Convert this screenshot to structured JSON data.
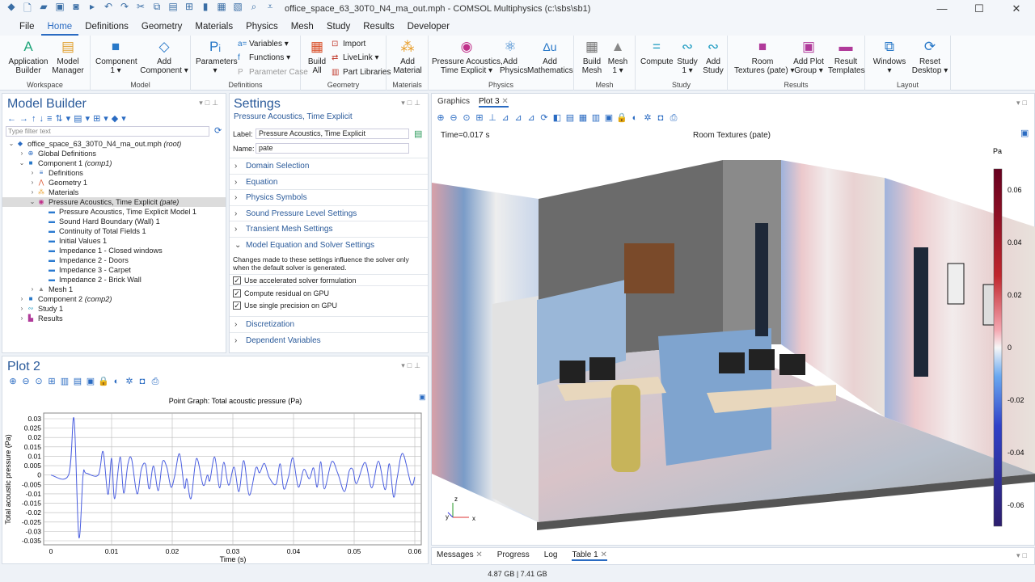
{
  "window": {
    "title": "office_space_63_30T0_N4_ma_out.mph - COMSOL Multiphysics (c:\\sbs\\sb1)",
    "quick_access_icons": [
      "app-icon",
      "new-icon",
      "open-icon",
      "save-icon",
      "save-as-icon",
      "run-icon",
      "undo-icon",
      "redo-icon",
      "cut-icon",
      "copy-icon",
      "paste-icon",
      "duplicate-icon",
      "delete-icon",
      "select-icon",
      "clear-icon",
      "find-icon",
      "customize-icon"
    ],
    "controls": [
      "minimize",
      "maximize",
      "close"
    ]
  },
  "menu": {
    "tabs": [
      "File",
      "Home",
      "Definitions",
      "Geometry",
      "Materials",
      "Physics",
      "Mesh",
      "Study",
      "Results",
      "Developer"
    ],
    "active": "Home"
  },
  "ribbon": {
    "workspace": {
      "label": "Workspace",
      "app_builder": "Application\nBuilder",
      "model_manager": "Model\nManager"
    },
    "model": {
      "label": "Model",
      "component": "Component\n1 ▾",
      "add_component": "Add\nComponent ▾"
    },
    "definitions": {
      "label": "Definitions",
      "parameters": "Parameters\n▾",
      "variables": "Variables ▾",
      "functions": "Functions ▾",
      "parameter_case": "Parameter Case"
    },
    "geometry": {
      "label": "Geometry",
      "build_all": "Build\nAll",
      "import": "Import",
      "livelink": "LiveLink ▾",
      "part_libraries": "Part Libraries"
    },
    "materials": {
      "label": "Materials",
      "add_material": "Add\nMaterial"
    },
    "physics": {
      "label": "Physics",
      "pressure_acoustics": "Pressure Acoustics,\nTime Explicit ▾",
      "add_physics": "Add\nPhysics",
      "add_mathematics": "Add\nMathematics"
    },
    "mesh": {
      "label": "Mesh",
      "build_mesh": "Build\nMesh",
      "mesh1": "Mesh\n1 ▾"
    },
    "study": {
      "label": "Study",
      "compute": "Compute",
      "study1": "Study\n1 ▾",
      "add_study": "Add\nStudy"
    },
    "results": {
      "label": "Results",
      "room_textures": "Room\nTextures (pate) ▾",
      "add_plot_group": "Add Plot\nGroup ▾",
      "result_templates": "Result\nTemplates"
    },
    "layout": {
      "label": "Layout",
      "windows": "Windows\n▾",
      "reset_desktop": "Reset\nDesktop ▾"
    }
  },
  "model_builder": {
    "title": "Model Builder",
    "filter_placeholder": "Type filter text",
    "tree": [
      {
        "label": "office_space_63_30T0_N4_ma_out.mph",
        "tag": "(root)",
        "level": 0,
        "exp": "v",
        "icon": "root"
      },
      {
        "label": "Global Definitions",
        "tag": "",
        "level": 1,
        "exp": ">",
        "icon": "globe"
      },
      {
        "label": "Component 1",
        "tag": "(comp1)",
        "level": 1,
        "exp": "v",
        "icon": "comp"
      },
      {
        "label": "Definitions",
        "tag": "",
        "level": 2,
        "exp": ">",
        "icon": "def"
      },
      {
        "label": "Geometry 1",
        "tag": "",
        "level": 2,
        "exp": ">",
        "icon": "geom"
      },
      {
        "label": "Materials",
        "tag": "",
        "level": 2,
        "exp": ">",
        "icon": "mat"
      },
      {
        "label": "Pressure Acoustics, Time Explicit",
        "tag": "(pate)",
        "level": 2,
        "exp": "v",
        "icon": "phys",
        "selected": true
      },
      {
        "label": "Pressure Acoustics, Time Explicit Model 1",
        "tag": "",
        "level": 3,
        "exp": "",
        "icon": "node"
      },
      {
        "label": "Sound Hard Boundary (Wall) 1",
        "tag": "",
        "level": 3,
        "exp": "",
        "icon": "node"
      },
      {
        "label": "Continuity of Total Fields 1",
        "tag": "",
        "level": 3,
        "exp": "",
        "icon": "node"
      },
      {
        "label": "Initial Values 1",
        "tag": "",
        "level": 3,
        "exp": "",
        "icon": "node"
      },
      {
        "label": "Impedance 1 - Closed windows",
        "tag": "",
        "level": 3,
        "exp": "",
        "icon": "node"
      },
      {
        "label": "Impedance 2 - Doors",
        "tag": "",
        "level": 3,
        "exp": "",
        "icon": "node"
      },
      {
        "label": "Impedance 3 - Carpet",
        "tag": "",
        "level": 3,
        "exp": "",
        "icon": "node"
      },
      {
        "label": "Impedance 2 - Brick Wall",
        "tag": "",
        "level": 3,
        "exp": "",
        "icon": "node"
      },
      {
        "label": "Mesh 1",
        "tag": "",
        "level": 2,
        "exp": ">",
        "icon": "mesh"
      },
      {
        "label": "Component 2",
        "tag": "(comp2)",
        "level": 1,
        "exp": ">",
        "icon": "comp"
      },
      {
        "label": "Study 1",
        "tag": "",
        "level": 1,
        "exp": ">",
        "icon": "study"
      },
      {
        "label": "Results",
        "tag": "",
        "level": 1,
        "exp": ">",
        "icon": "results"
      }
    ]
  },
  "settings": {
    "title": "Settings",
    "subtitle": "Pressure Acoustics, Time Explicit",
    "label_caption": "Label:",
    "label_value": "Pressure Acoustics, Time Explicit",
    "name_caption": "Name:",
    "name_value": "pate",
    "sections_before": [
      "Domain Selection",
      "Equation",
      "Physics Symbols",
      "Sound Pressure Level Settings",
      "Transient Mesh Settings"
    ],
    "expanded_section": "Model Equation and Solver Settings",
    "note": "Changes made to these settings influence the solver only when the default solver is generated.",
    "checkboxes": [
      {
        "label": "Use accelerated solver formulation",
        "checked": true
      },
      {
        "label": "Compute residual on GPU",
        "checked": true
      },
      {
        "label": "Use single precision on GPU",
        "checked": true
      }
    ],
    "sections_after": [
      "Discretization",
      "Dependent Variables"
    ]
  },
  "plot2": {
    "title": "Plot 2"
  },
  "graphics": {
    "tabs": [
      "Graphics",
      "Plot 3"
    ],
    "active_tab": "Plot 3",
    "time_label": "Time=0.017 s",
    "plot_title": "Room Textures (pate)",
    "colorbar_unit": "Pa",
    "colorbar_ticks": [
      "0.06",
      "0.04",
      "0.02",
      "0",
      "-0.02",
      "-0.04",
      "-0.06"
    ],
    "colorbar_range": [
      -0.068,
      0.068
    ],
    "colors": {
      "max": "#67001f",
      "mid": "#f7f7f7",
      "min": "#2d1e6e"
    },
    "axes": [
      "z",
      "y",
      "x"
    ]
  },
  "bottom_tabs": {
    "tabs": [
      "Messages",
      "Progress",
      "Log",
      "Table 1"
    ],
    "active": "Table 1"
  },
  "status": {
    "memory": "4.87 GB | 7.41 GB"
  },
  "chart_data": {
    "type": "line",
    "title": "Point Graph: Total acoustic pressure (Pa)",
    "xlabel": "Time (s)",
    "ylabel": "Total acoustic pressure (Pa)",
    "xlim": [
      0,
      0.06
    ],
    "ylim": [
      -0.035,
      0.03
    ],
    "grid": true,
    "color": "#4a5ee0",
    "xticks": [
      "0",
      "0.01",
      "0.02",
      "0.03",
      "0.04",
      "0.05",
      "0.06"
    ],
    "yticks": [
      "0.03",
      "0.025",
      "0.02",
      "0.015",
      "0.01",
      "0.005",
      "0",
      "-0.005",
      "-0.01",
      "-0.015",
      "-0.02",
      "-0.025",
      "-0.03",
      "-0.035"
    ],
    "x": [
      0,
      0.0029,
      0.0038,
      0.0046,
      0.0053,
      0.0058,
      0.0078,
      0.0086,
      0.0094,
      0.01,
      0.0105,
      0.0114,
      0.012,
      0.0127,
      0.0133,
      0.0142,
      0.0149,
      0.0156,
      0.0162,
      0.0169,
      0.0177,
      0.0184,
      0.0191,
      0.0198,
      0.0204,
      0.0212,
      0.022,
      0.0224,
      0.0231,
      0.024,
      0.0251,
      0.0258,
      0.0262,
      0.027,
      0.0278,
      0.0285,
      0.0293,
      0.0302,
      0.031,
      0.0318,
      0.0327,
      0.0338,
      0.0344,
      0.0352,
      0.036,
      0.0371,
      0.0378,
      0.0384,
      0.0392,
      0.0399,
      0.0408,
      0.0417,
      0.0426,
      0.0433,
      0.0439,
      0.0445,
      0.0451,
      0.0463,
      0.0473,
      0.0484,
      0.0492,
      0.0498,
      0.0504,
      0.0518,
      0.0529,
      0.054,
      0.0551,
      0.0558,
      0.0565,
      0.0571,
      0.058,
      0.0594,
      0.06
    ],
    "y": [
      0,
      0,
      0.03,
      -0.033,
      0,
      0.001,
      0,
      0.0125,
      -0.0103,
      0.009,
      -0.0126,
      0.0096,
      -0.0096,
      0.006,
      0.0085,
      -0.01,
      0.003,
      0.0057,
      -0.0074,
      0.0048,
      -0.0083,
      0.0071,
      0.0042,
      -0.0064,
      -0.0006,
      0.0113,
      -0.0068,
      -0.002,
      -0.0125,
      0.0088,
      -0.0054,
      0,
      -0.003,
      0.0096,
      -0.0068,
      0.0068,
      -0.0054,
      0.0042,
      -0.0088,
      0.0077,
      -0.0107,
      0.0038,
      0.0012,
      0.0062,
      -0.0013,
      -0.0049,
      0.006,
      -0.0074,
      -0.0006,
      0.0091,
      -0.0064,
      0.003,
      -0.002,
      0.0038,
      -0.0064,
      0.0071,
      -0.0074,
      0.0071,
      0.0009,
      -0.0088,
      0.0023,
      0.0028,
      -0.0045,
      0.0067,
      -0.0068,
      0.0074,
      -0.0078,
      0.006,
      -0.0117,
      -0.0013,
      0.0115,
      -0.0049,
      -0.001
    ]
  }
}
